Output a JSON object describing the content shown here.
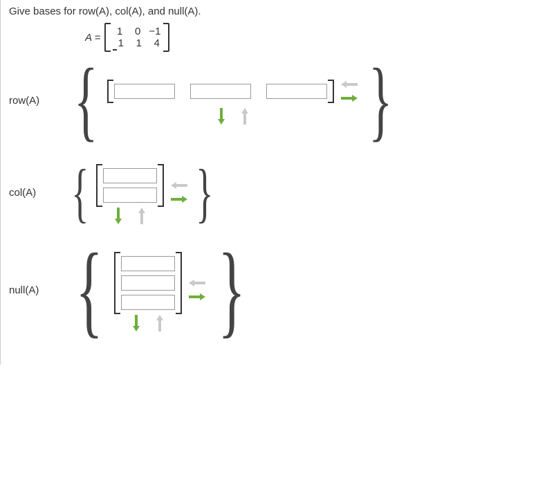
{
  "question": "Give bases for row(A), col(A), and null(A).",
  "matrixDef": {
    "lhs": "A =",
    "rows": [
      [
        "1",
        "0",
        "−1"
      ],
      [
        "1",
        "1",
        "4"
      ]
    ]
  },
  "labels": {
    "row": "row(A)",
    "col": "col(A)",
    "null": "null(A)"
  },
  "inputs": {
    "row": [
      "",
      "",
      ""
    ],
    "col": [
      "",
      ""
    ],
    "null": [
      "",
      "",
      ""
    ]
  },
  "icons": {
    "arrowLeft": "arrow-left",
    "arrowRight": "arrow-right",
    "arrowUp": "arrow-up",
    "arrowDown": "arrow-down"
  }
}
